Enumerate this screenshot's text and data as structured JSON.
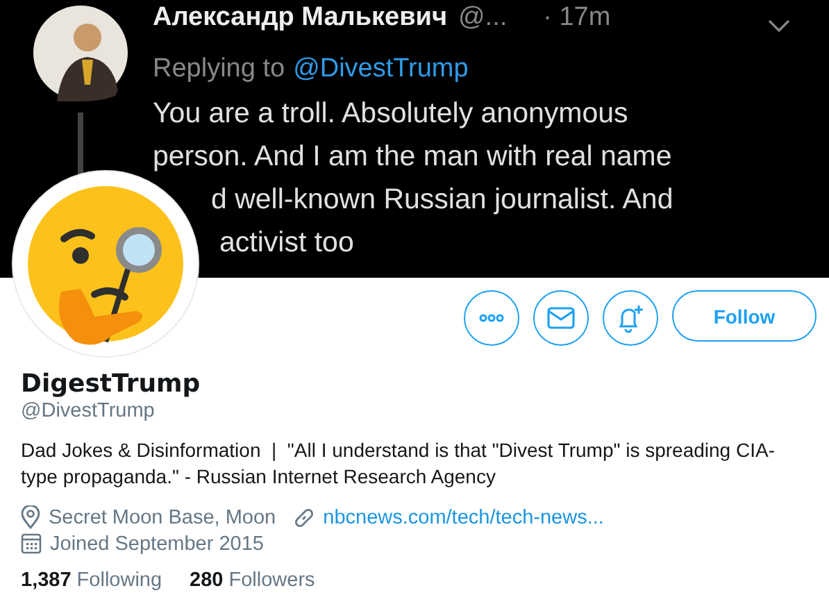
{
  "banner": {
    "kind": "tweet_screenshot",
    "author": "Александр Малькевич",
    "handle": "@...",
    "time": "· 17m",
    "replying_label": "Replying to",
    "replying_to": "@DivestTrump",
    "lines": [
      "You are a troll. Absolutely anonymous",
      "person. And I am the man with real name",
      "d well-known Russian journalist. And",
      "activist too"
    ]
  },
  "actions": [
    {
      "kind": "more"
    },
    {
      "kind": "message"
    },
    {
      "kind": "notify"
    }
  ],
  "follow_button": "Follow",
  "profile": {
    "name": "DigestTrump",
    "handle": "@DivestTrump",
    "bio": "Dad Jokes & Disinformation  |  \"All I understand is that \"Divest Trump\" is spreading CIA-type propaganda.\" - Russian Internet Research Agency",
    "location": "Secret Moon Base, Moon",
    "website": "nbcnews.com/tech/tech-news...",
    "joined": "Joined September 2015"
  },
  "stats": [
    {
      "count": "1,387",
      "label": "Following"
    },
    {
      "count": "280",
      "label": "Followers"
    }
  ]
}
